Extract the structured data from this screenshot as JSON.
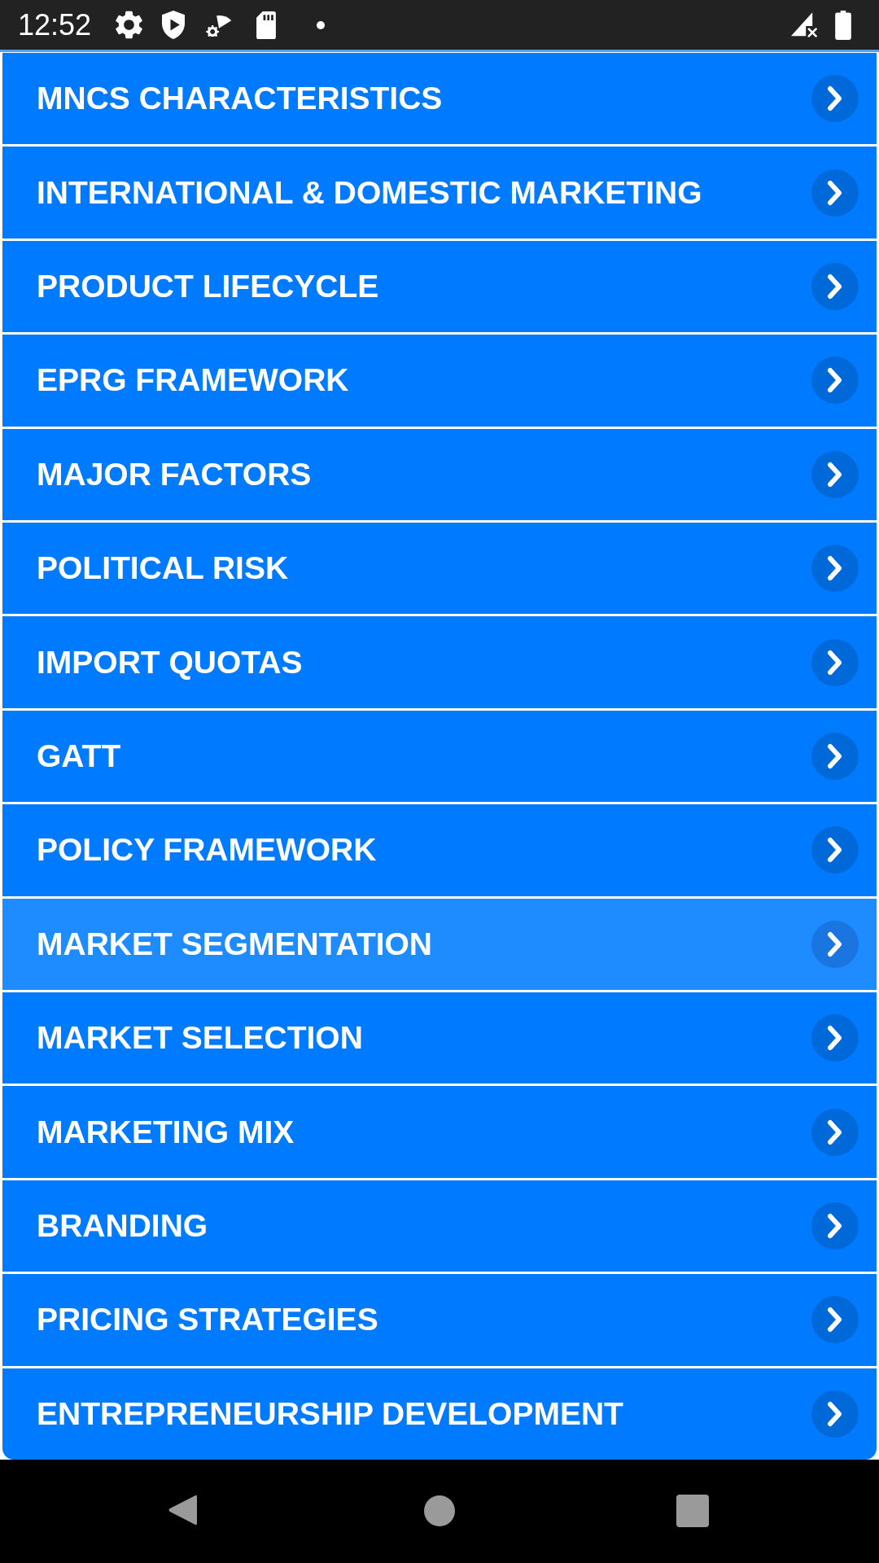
{
  "status_bar": {
    "time": "12:52"
  },
  "topics": [
    {
      "label": "MNCS CHARACTERISTICS",
      "selected": false
    },
    {
      "label": "INTERNATIONAL & DOMESTIC MARKETING",
      "selected": false
    },
    {
      "label": "PRODUCT LIFECYCLE",
      "selected": false
    },
    {
      "label": "EPRG FRAMEWORK",
      "selected": false
    },
    {
      "label": "MAJOR FACTORS",
      "selected": false
    },
    {
      "label": "POLITICAL RISK",
      "selected": false
    },
    {
      "label": "IMPORT QUOTAS",
      "selected": false
    },
    {
      "label": "GATT",
      "selected": false
    },
    {
      "label": "POLICY FRAMEWORK",
      "selected": false
    },
    {
      "label": "MARKET SEGMENTATION",
      "selected": true
    },
    {
      "label": "MARKET SELECTION",
      "selected": false
    },
    {
      "label": "MARKETING MIX",
      "selected": false
    },
    {
      "label": "BRANDING",
      "selected": false
    },
    {
      "label": "PRICING STRATEGIES",
      "selected": false
    },
    {
      "label": "ENTREPRENEURSHIP DEVELOPMENT",
      "selected": false
    }
  ]
}
